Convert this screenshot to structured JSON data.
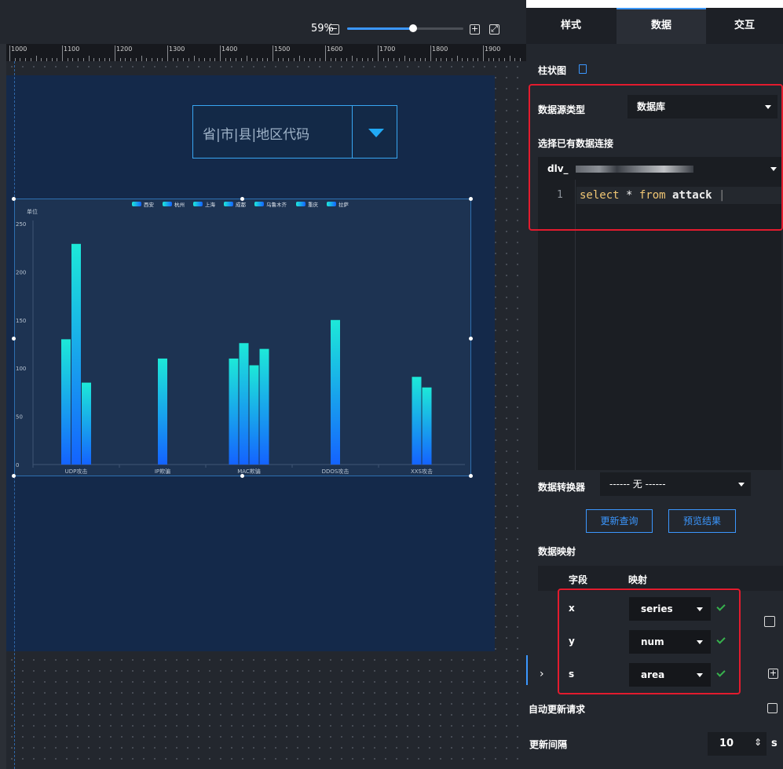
{
  "zoom": {
    "percent": "59%",
    "minus_icon": "minus-square-icon",
    "plus_icon": "plus-square-icon",
    "fit_icon": "fit-screen-icon",
    "level": 0.59
  },
  "ruler": {
    "labels": [
      "1000",
      "1100",
      "1200",
      "1300",
      "1400",
      "1500",
      "1600",
      "1700",
      "1800",
      "1900"
    ]
  },
  "canvas": {
    "background": "#14294a"
  },
  "region_select": {
    "placeholder": "省|市|县|地区代码"
  },
  "chart_data": {
    "type": "bar",
    "ylabel": "单位",
    "ylim": [
      0,
      250
    ],
    "yticks": [
      "0",
      "50",
      "100",
      "150",
      "200",
      "250"
    ],
    "categories": [
      "UDP攻击",
      "IP欺骗",
      "MAC欺骗",
      "DDOS攻击",
      "XXS攻击"
    ],
    "legend_position": "top",
    "series": [
      {
        "name": "西安",
        "values": [
          130,
          0,
          0,
          0,
          0
        ]
      },
      {
        "name": "杭州",
        "values": [
          229,
          0,
          0,
          0,
          0
        ]
      },
      {
        "name": "上海",
        "values": [
          85,
          0,
          0,
          0,
          0
        ]
      },
      {
        "name": "成都",
        "values": [
          0,
          110,
          110,
          150,
          0
        ]
      },
      {
        "name": "乌鲁木齐",
        "values": [
          0,
          0,
          126,
          0,
          91
        ]
      },
      {
        "name": "重庆",
        "values": [
          0,
          0,
          103,
          0,
          80
        ]
      },
      {
        "name": "拉萨",
        "values": [
          0,
          0,
          120,
          0,
          0
        ]
      }
    ],
    "bar_gradient": [
      "#1de9d8",
      "#1463ff"
    ]
  },
  "panel": {
    "tabs": [
      "样式",
      "数据",
      "交互"
    ],
    "active_tab": "数据",
    "component_title": "柱状图",
    "component_icon": "document-icon",
    "source_type_label": "数据源类型",
    "source_type_value": "数据库",
    "connection_label": "选择已有数据连接",
    "connection_value": "dlv_",
    "editor": {
      "line_number": "1",
      "code_select": "select",
      "code_rest": " * ",
      "code_from": "from",
      "code_table": " attack"
    },
    "transformer_label": "数据转换器",
    "transformer_value": "------ 无 ------",
    "refresh_button": "更新查询",
    "preview_button": "预览结果",
    "mapping_title": "数据映射",
    "mapping_col_field": "字段",
    "mapping_col_map": "映射",
    "mappings": [
      {
        "field": "x",
        "value": "series"
      },
      {
        "field": "y",
        "value": "num"
      },
      {
        "field": "s",
        "value": "area"
      }
    ],
    "auto_update_label": "自动更新请求",
    "interval_label": "更新间隔",
    "interval_value": "10",
    "interval_unit": "s",
    "accent": "#3b97ff",
    "highlight": "#e31b2e"
  }
}
